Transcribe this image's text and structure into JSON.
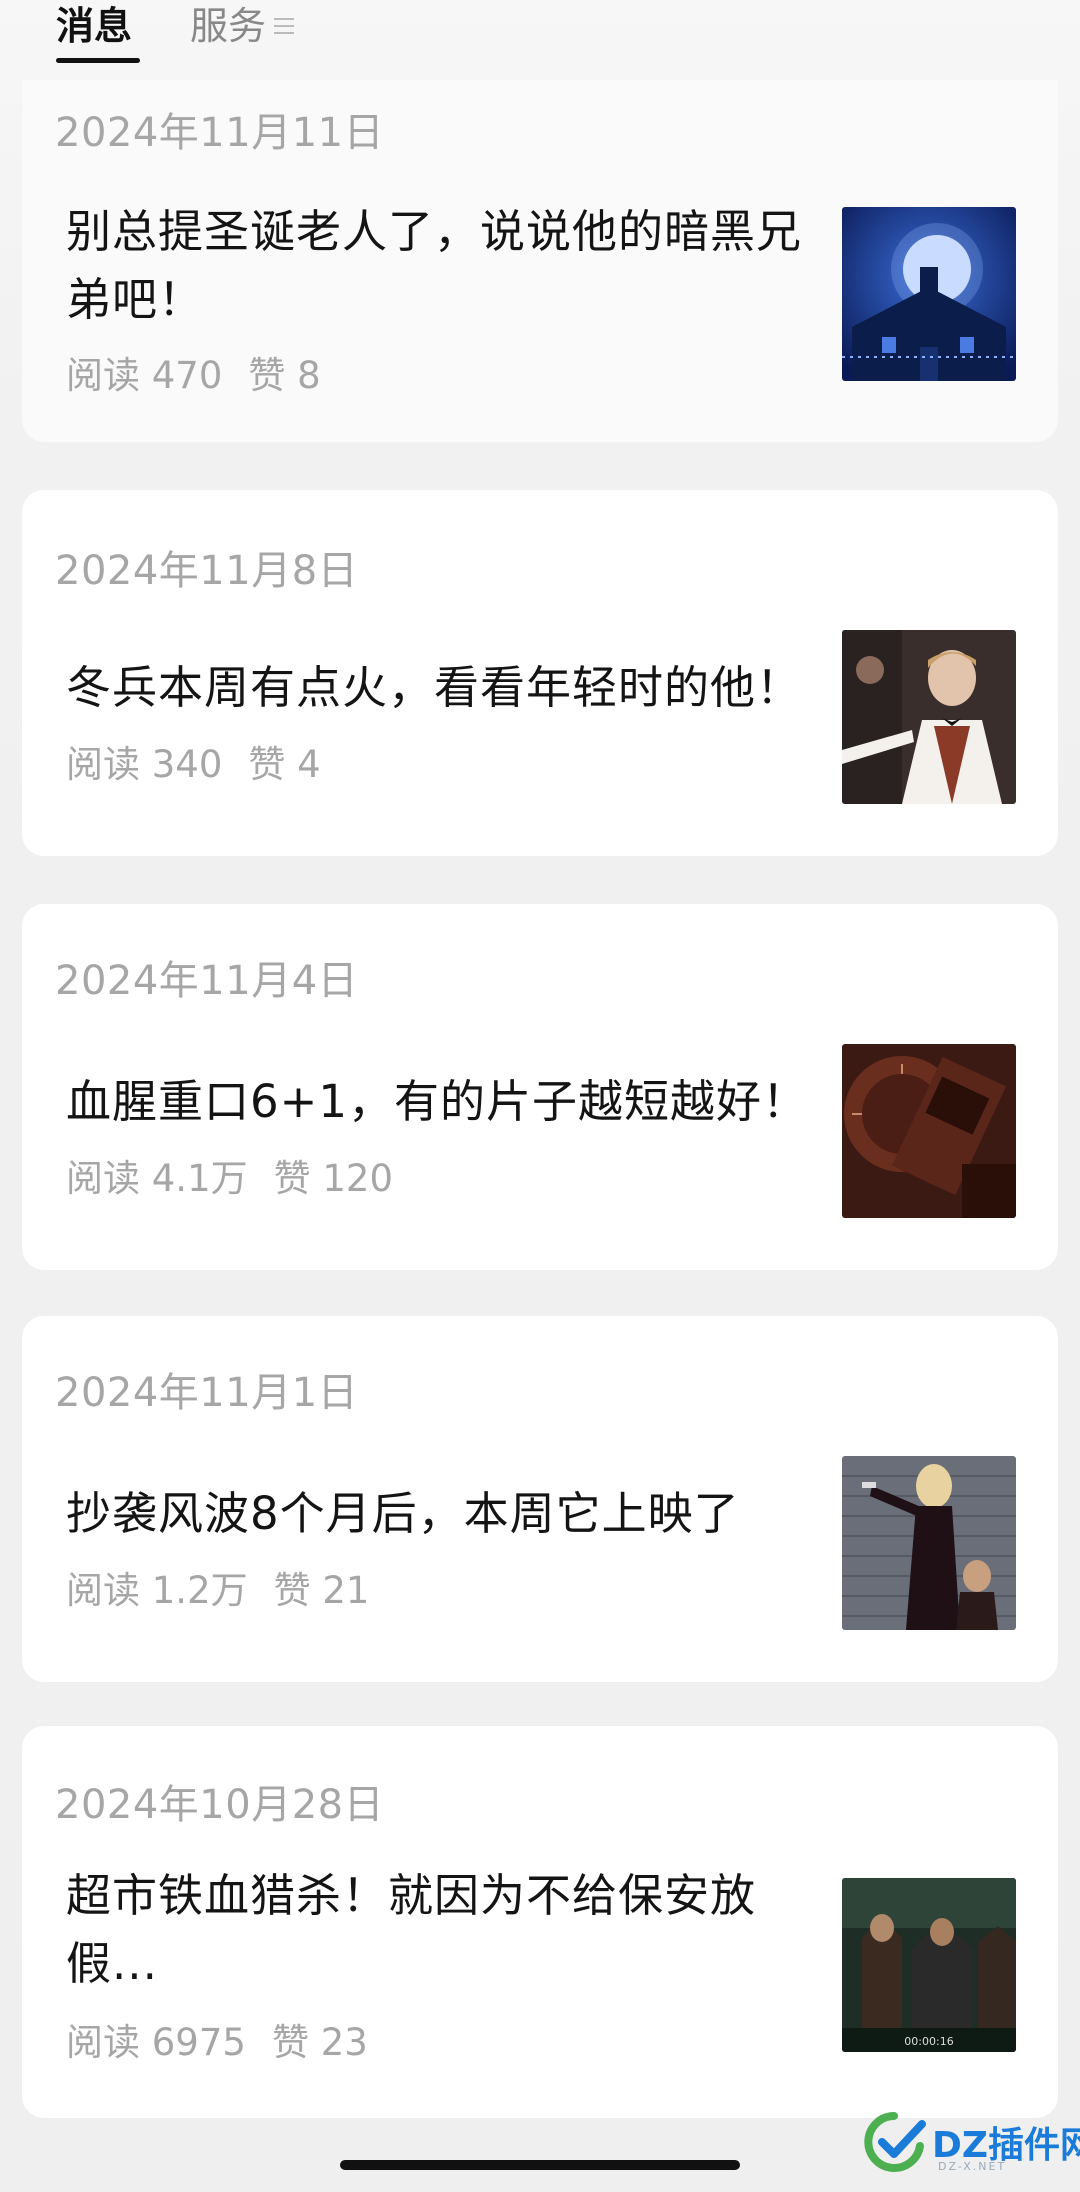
{
  "tabs": {
    "messages": "消息",
    "service": "服务"
  },
  "articles": [
    {
      "date": "2024年11月11日",
      "title": "别总提圣诞老人了，说说他的暗黑兄弟吧！",
      "reads": "阅读 470",
      "likes": "赞 8",
      "thumb_icon": "moon-house-image"
    },
    {
      "date": "2024年11月8日",
      "title": "冬兵本周有点火，看看年轻时的他！",
      "reads": "阅读 340",
      "likes": "赞 4",
      "thumb_icon": "man-in-tuxedo-image"
    },
    {
      "date": "2024年11月4日",
      "title": "血腥重口6+1，有的片子越短越好！",
      "reads": "阅读 4.1万",
      "likes": "赞 120",
      "thumb_icon": "clock-gadget-image"
    },
    {
      "date": "2024年11月1日",
      "title": "抄袭风波8个月后，本周它上映了",
      "reads": "阅读 1.2万",
      "likes": "赞 21",
      "thumb_icon": "woman-pointing-gun-image"
    },
    {
      "date": "2024年10月28日",
      "title": "超市铁血猎杀！就因为不给保安放假...",
      "reads": "阅读 6975",
      "likes": "赞 23",
      "thumb_icon": "video-frame-image",
      "thumb_timestamp": "00:00:16"
    }
  ],
  "watermark": {
    "text": "DZ插件网",
    "sub": "DZ-X.NET"
  },
  "colors": {
    "meta_gray": "#a6a6a6",
    "watermark_blue": "#1a7bd9",
    "watermark_green": "#4caf50"
  }
}
